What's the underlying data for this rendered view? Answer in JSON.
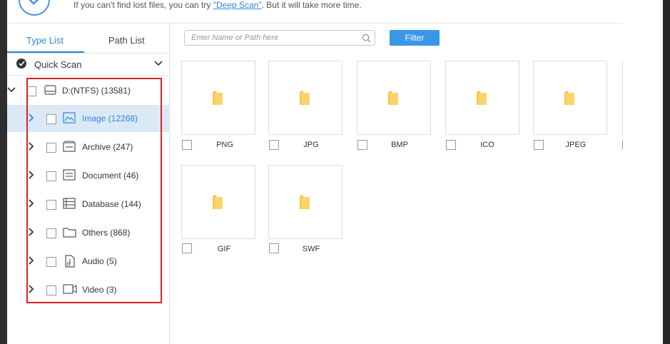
{
  "header": {
    "hint_prefix": "If you can't find lost files, you can try ",
    "hint_link": "\"Deep Scan\"",
    "hint_suffix": ". But it will take more time."
  },
  "tabs": [
    {
      "label": "Type List",
      "active": true
    },
    {
      "label": "Path List",
      "active": false
    }
  ],
  "scan": {
    "label": "Quick Scan"
  },
  "tree": {
    "root": {
      "label": "D:(NTFS) (13581)"
    },
    "items": [
      {
        "label": "Image (12268)",
        "icon": "image-icon",
        "selected": true
      },
      {
        "label": "Archive (247)",
        "icon": "archive-icon"
      },
      {
        "label": "Document (46)",
        "icon": "document-icon"
      },
      {
        "label": "Database (144)",
        "icon": "database-icon"
      },
      {
        "label": "Others (868)",
        "icon": "folder-icon"
      },
      {
        "label": "Audio (5)",
        "icon": "audio-icon"
      },
      {
        "label": "Video (3)",
        "icon": "video-icon"
      }
    ]
  },
  "search": {
    "placeholder": "Enter Name or Path here"
  },
  "filter": {
    "label": "Filter"
  },
  "tiles": [
    {
      "label": "PNG"
    },
    {
      "label": "JPG"
    },
    {
      "label": "BMP"
    },
    {
      "label": "ICO"
    },
    {
      "label": "JPEG"
    },
    {
      "label": "GIF"
    },
    {
      "label": "SWF"
    }
  ],
  "colors": {
    "accent": "#2e86de",
    "filter_button": "#3a97e8",
    "highlight_box": "#e02020",
    "selected_row": "#dbe9f7",
    "folder": "#f5c542"
  }
}
